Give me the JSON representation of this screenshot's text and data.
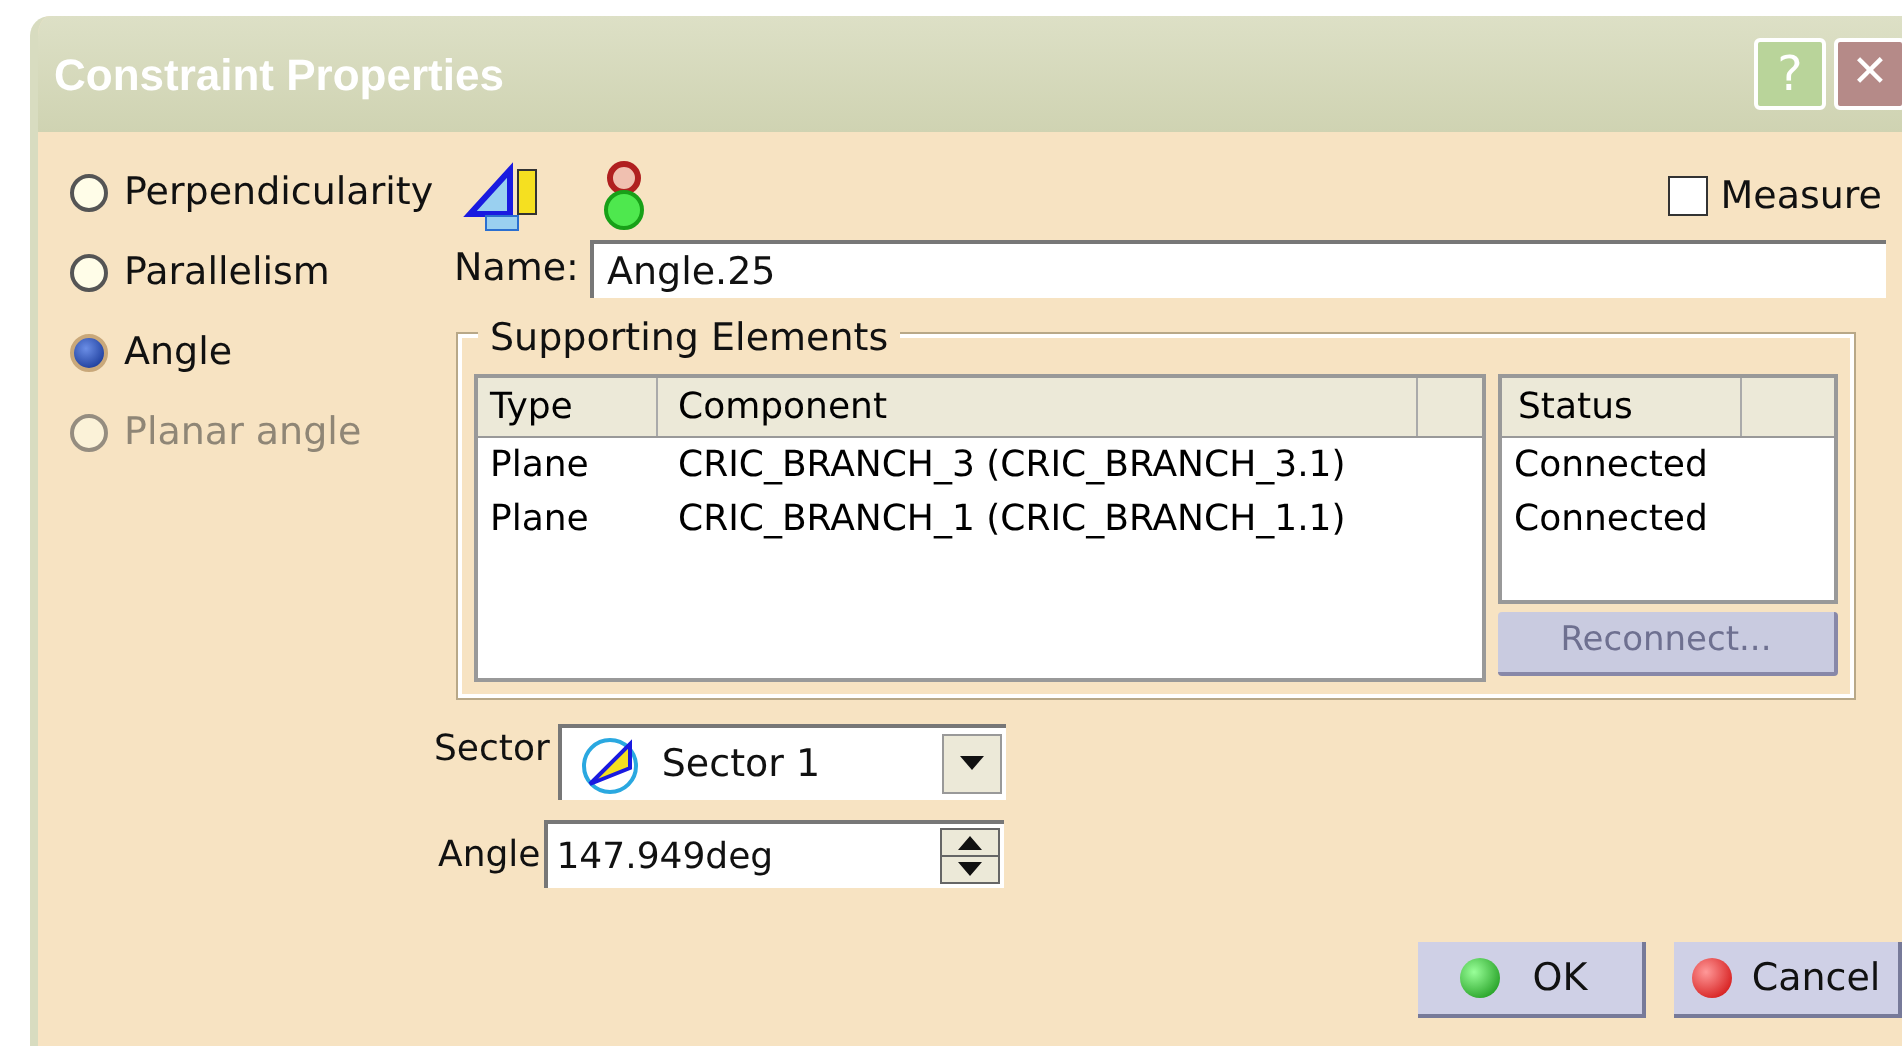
{
  "window": {
    "title": "Constraint Properties",
    "help": "?",
    "close": "✕"
  },
  "constraint_types": [
    {
      "label": "Perpendicularity",
      "selected": false,
      "disabled": false
    },
    {
      "label": "Parallelism",
      "selected": false,
      "disabled": false
    },
    {
      "label": "Angle",
      "selected": true,
      "disabled": false
    },
    {
      "label": "Planar angle",
      "selected": false,
      "disabled": true
    }
  ],
  "measure": {
    "label": "Measure",
    "checked": false
  },
  "name": {
    "label": "Name:",
    "value": "Angle.25"
  },
  "supporting_elements": {
    "title": "Supporting Elements",
    "columns": [
      "Type",
      "Component"
    ],
    "rows": [
      {
        "type": "Plane",
        "component": "CRIC_BRANCH_3 (CRIC_BRANCH_3.1)"
      },
      {
        "type": "Plane",
        "component": "CRIC_BRANCH_1 (CRIC_BRANCH_1.1)"
      }
    ],
    "status_column": "Status",
    "statuses": [
      "Connected",
      "Connected"
    ],
    "reconnect": {
      "label": "Reconnect...",
      "disabled": true
    }
  },
  "sector": {
    "label": "Sector",
    "value": "Sector 1"
  },
  "angle": {
    "label": "Angle",
    "value": "147.949deg"
  },
  "buttons": [
    {
      "label": "OK",
      "kind": "ok"
    },
    {
      "label": "Cancel",
      "kind": "cancel"
    }
  ]
}
